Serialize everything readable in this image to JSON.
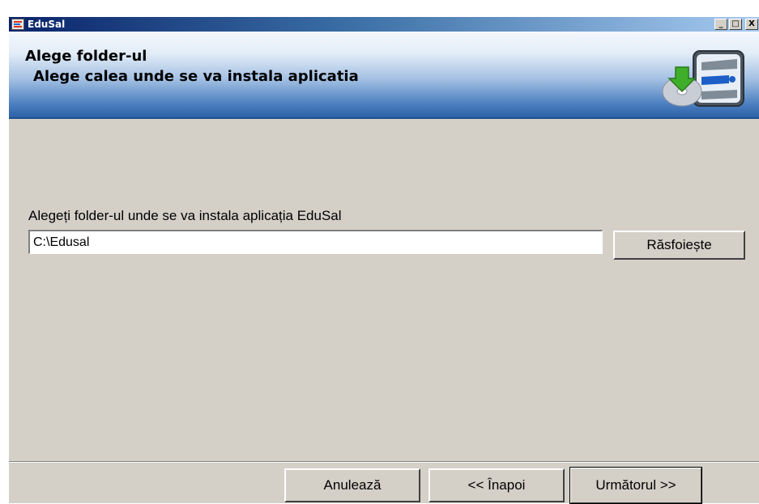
{
  "window": {
    "title": "EduSal",
    "controls": {
      "minimize": "_",
      "maximize": "□",
      "close": "X"
    }
  },
  "header": {
    "title": "Alege folder-ul",
    "subtitle": "Alege calea unde se va instala aplicatia",
    "logo_icon": "install-disc-logo-icon"
  },
  "body": {
    "prompt": "Alegeți folder-ul unde se va instala aplicația EduSal",
    "path_value": "C:\\Edusal",
    "browse_label": "Răsfoiește"
  },
  "footer": {
    "cancel_label": "Anulează",
    "back_label": "<< Înapoi",
    "next_label": "Următorul >>"
  },
  "colors": {
    "titlebar_start": "#0a246a",
    "titlebar_end": "#a6caf0",
    "dialog_face": "#d4d0c8"
  }
}
